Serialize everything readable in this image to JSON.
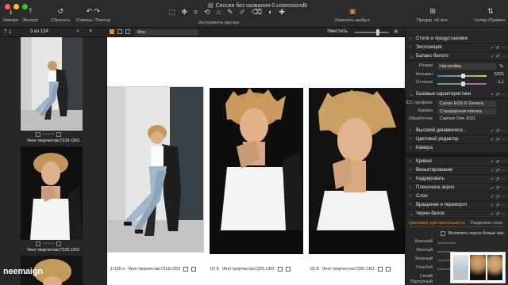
{
  "window": {
    "title": "Сессия без названия-0.cosessiondb"
  },
  "toolbar": {
    "import": "Импорт",
    "export": "Экспорт",
    "reset": "Сбросить",
    "undo_redo": "Отмена / Повтор",
    "cursor_tools": "Инструменты курсора",
    "edit_selected": "Изменить выбр-е",
    "preview": "Предпр. об.исп.",
    "copy_apply": "Копир./Примен."
  },
  "browser_bar": {
    "count": "3 из 134",
    "background_label": "Фон",
    "fit_label": "Уместить"
  },
  "filmstrip": {
    "items": [
      {
        "filename": "!Аня творчество7218.CR3"
      },
      {
        "filename": "!Аня творчество7225.CR3"
      },
      {
        "filename": "!Аня творчество7236.CR3"
      }
    ]
  },
  "viewer": {
    "cards": [
      {
        "shutter": "1/100 s",
        "filename": "!Аня творчество7218.CR3"
      },
      {
        "aperture": "f/2.8",
        "filename": "!Аня творчество7225.CR3"
      },
      {
        "aperture": "f/2.8",
        "filename": "!Аня творчество7236.CR3"
      }
    ]
  },
  "panel": {
    "styles": "Стили и предустановки",
    "exposure": "Экспозиция",
    "white_balance": "Баланс белого",
    "wb_mode_label": "Режим",
    "wb_mode_value": "Настройка",
    "kelvin_label": "Кельвин",
    "kelvin_value": "5221",
    "tint_label": "Оттенок",
    "tint_value": "-1,1",
    "base_characteristics": "Базовые характеристики",
    "icc_label": "ICC профиль",
    "icc_value": "Canon EOS R Generic",
    "curve_label": "Кривая",
    "curve_value": "Стандартная пленка",
    "processing_label": "Обработчик",
    "processing_value": "Capture One 2021",
    "hdr": "Высокий динамическ...",
    "color_editor": "Цветовой редактор",
    "camera": "Камера",
    "curve": "Кривая",
    "vignetting": "Виньетирование",
    "crop": "Кадрировать",
    "film_grain": "Пленочное зерно",
    "layers": "Слои",
    "rotation": "Вращение и переворот",
    "bw": "Черно-белое",
    "bw_tab1": "Цветовая чувствительность",
    "bw_tab2": "Разделить тона",
    "bw_toggle": "Включить черно-белые изо.",
    "bw_colors": [
      "Красный",
      "Желтый",
      "Зеленый",
      "Голубой",
      "Синий",
      "Пурпурный"
    ]
  },
  "logo": "neemaign",
  "colors": {
    "accent": "#e88a2c",
    "panel": "#282828",
    "viewer_bg": "#ffffff",
    "toolbar": "#2b2b2b"
  }
}
